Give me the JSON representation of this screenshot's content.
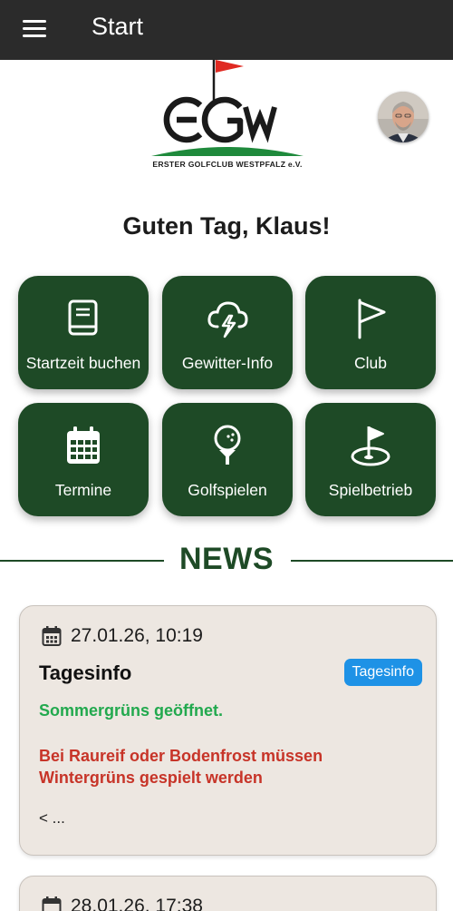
{
  "topbar": {
    "title": "Start"
  },
  "logo": {
    "caption": "ERSTER GOLFCLUB WESTPFALZ e.V."
  },
  "greeting": "Guten Tag, Klaus!",
  "tiles": [
    {
      "label": "Startzeit buchen",
      "icon": "book-icon"
    },
    {
      "label": "Gewitter-Info",
      "icon": "thunderstorm-icon"
    },
    {
      "label": "Club",
      "icon": "flag-icon"
    },
    {
      "label": "Termine",
      "icon": "calendar-icon"
    },
    {
      "label": "Golfspielen",
      "icon": "golf-ball-on-tee-icon"
    },
    {
      "label": "Spielbetrieb",
      "icon": "golf-hole-flag-icon"
    }
  ],
  "news": {
    "heading": "NEWS",
    "items": [
      {
        "date": "27.01.26, 10:19",
        "title": "Tagesinfo",
        "badge": "Tagesinfo",
        "green_text": "Sommergrüns geöffnet.",
        "red_text": "Bei Raureif oder Bodenfrost müssen Wintergrüns gespielt werden",
        "more": "< ..."
      },
      {
        "date": "28.01.26, 17:38"
      }
    ]
  },
  "colors": {
    "topbar": "#2b2b2b",
    "tile_green": "#1e4a26",
    "card_bg": "#ede7e1",
    "badge_blue": "#1e92e6",
    "text_green": "#22a94e",
    "text_red": "#c73428"
  }
}
